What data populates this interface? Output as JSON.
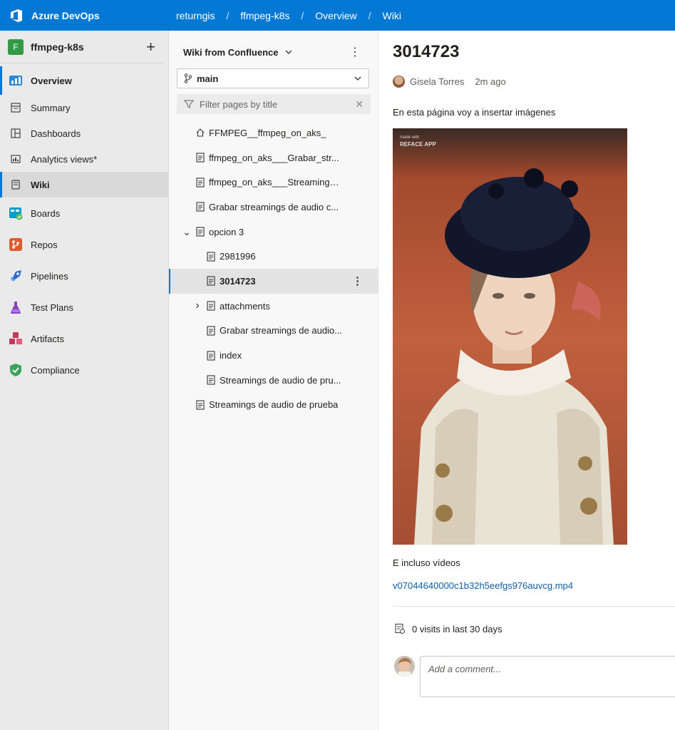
{
  "app": {
    "name": "Azure DevOps"
  },
  "breadcrumb": [
    "returngis",
    "ffmpeg-k8s",
    "Overview",
    "Wiki"
  ],
  "project": {
    "initial": "F",
    "name": "ffmpeg-k8s",
    "avatar_color": "#339947"
  },
  "nav": {
    "overview": "Overview",
    "sub_items": [
      "Summary",
      "Dashboards",
      "Analytics views*",
      "Wiki"
    ],
    "main_items": [
      "Boards",
      "Repos",
      "Pipelines",
      "Test Plans",
      "Artifacts",
      "Compliance"
    ]
  },
  "wiki": {
    "title": "Wiki from Confluence",
    "branch": "main",
    "filter_placeholder": "Filter pages by title",
    "tree": [
      {
        "label": "FFMPEG__ffmpeg_on_aks_",
        "icon": "home-icon",
        "level": 0
      },
      {
        "label": "ffmpeg_on_aks___Grabar_str...",
        "icon": "page-icon",
        "level": 0
      },
      {
        "label": "ffmpeg_on_aks___Streamings...",
        "icon": "page-icon",
        "level": 0
      },
      {
        "label": "Grabar streamings de audio c...",
        "icon": "page-icon",
        "level": 0
      },
      {
        "label": "opcion 3",
        "icon": "page-icon",
        "level": 0,
        "expander": "expanded"
      },
      {
        "label": "2981996",
        "icon": "page-icon",
        "level": 1
      },
      {
        "label": "3014723",
        "icon": "page-icon",
        "level": 1,
        "selected": true
      },
      {
        "label": "attachments",
        "icon": "page-icon",
        "level": 1,
        "expander": "collapsed"
      },
      {
        "label": "Grabar streamings de audio...",
        "icon": "page-icon",
        "level": 1
      },
      {
        "label": "index",
        "icon": "page-icon",
        "level": 1
      },
      {
        "label": "Streamings de audio de pru...",
        "icon": "page-icon",
        "level": 1
      },
      {
        "label": "Streamings de audio de prueba",
        "icon": "page-icon",
        "level": 0
      }
    ]
  },
  "page": {
    "title": "3014723",
    "author": "Gisela Torres",
    "time": "2m ago",
    "para1": "En esta página voy a insertar imágenes",
    "image_watermark_line1": "made with",
    "image_watermark_line2": "REFACE APP",
    "para2": "E incluso vídeos",
    "video_link": "v07044640000c1b32h5eefgs976auvcg.mp4",
    "visits": "0 visits in last 30 days",
    "comment_placeholder": "Add a comment..."
  },
  "colors": {
    "accent": "#0078d4",
    "link": "#0f5eaa"
  }
}
